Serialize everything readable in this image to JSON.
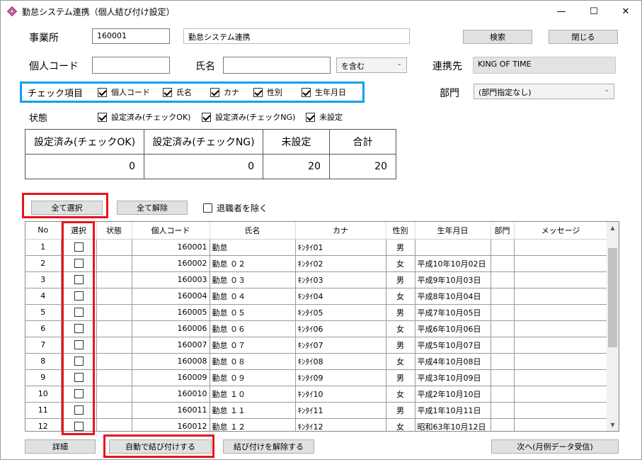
{
  "window": {
    "title": "勤怠システム連携（個人結び付け設定）",
    "minimize": "—",
    "maximize": "☐",
    "close": "✕"
  },
  "office": {
    "label": "事業所",
    "code": "160001",
    "name": "勤怠システム連携"
  },
  "search_button": "検索",
  "close_button": "閉じる",
  "person": {
    "code_label": "個人コード",
    "code_value": "",
    "name_label": "氏名",
    "name_value": "",
    "match_select": "を含む"
  },
  "partner": {
    "label": "連携先",
    "value": "KING OF TIME"
  },
  "check_items": {
    "label": "チェック項目",
    "options": [
      {
        "label": "個人コード",
        "checked": true
      },
      {
        "label": "氏名",
        "checked": true
      },
      {
        "label": "カナ",
        "checked": true
      },
      {
        "label": "性別",
        "checked": true
      },
      {
        "label": "生年月日",
        "checked": true
      }
    ]
  },
  "department": {
    "label": "部門",
    "value": "(部門指定なし)"
  },
  "status": {
    "label": "状態",
    "options": [
      {
        "label": "設定済み(チェックOK)",
        "checked": true
      },
      {
        "label": "設定済み(チェックNG)",
        "checked": true
      },
      {
        "label": "未設定",
        "checked": true
      }
    ]
  },
  "summary": {
    "headers": [
      "設定済み(チェックOK)",
      "設定済み(チェックNG)",
      "未設定",
      "合計"
    ],
    "values": [
      "0",
      "0",
      "20",
      "20"
    ]
  },
  "select_all_button": "全て選択",
  "deselect_all_button": "全て解除",
  "exclude_retired": {
    "label": "退職者を除く",
    "checked": false
  },
  "grid": {
    "columns": [
      "No",
      "選択",
      "状態",
      "個人コード",
      "氏名",
      "カナ",
      "性別",
      "生年月日",
      "部門",
      "メッセージ"
    ],
    "rows": [
      {
        "no": "1",
        "status": "",
        "code": "160001",
        "name": "勤怠",
        "kana": "ｷﾝﾀｲ01",
        "gender": "男",
        "birth": ""
      },
      {
        "no": "2",
        "status": "",
        "code": "160002",
        "name": "勤怠 ０２",
        "kana": "ｷﾝﾀｲ02",
        "gender": "女",
        "birth": "平成10年10月02日"
      },
      {
        "no": "3",
        "status": "",
        "code": "160003",
        "name": "勤怠 ０３",
        "kana": "ｷﾝﾀｲ03",
        "gender": "男",
        "birth": "平成9年10月03日"
      },
      {
        "no": "4",
        "status": "",
        "code": "160004",
        "name": "勤怠 ０４",
        "kana": "ｷﾝﾀｲ04",
        "gender": "女",
        "birth": "平成8年10月04日"
      },
      {
        "no": "5",
        "status": "",
        "code": "160005",
        "name": "勤怠 ０５",
        "kana": "ｷﾝﾀｲ05",
        "gender": "男",
        "birth": "平成7年10月05日"
      },
      {
        "no": "6",
        "status": "",
        "code": "160006",
        "name": "勤怠 ０６",
        "kana": "ｷﾝﾀｲ06",
        "gender": "女",
        "birth": "平成6年10月06日"
      },
      {
        "no": "7",
        "status": "",
        "code": "160007",
        "name": "勤怠 ０７",
        "kana": "ｷﾝﾀｲ07",
        "gender": "男",
        "birth": "平成5年10月07日"
      },
      {
        "no": "8",
        "status": "",
        "code": "160008",
        "name": "勤怠 ０８",
        "kana": "ｷﾝﾀｲ08",
        "gender": "女",
        "birth": "平成4年10月08日"
      },
      {
        "no": "9",
        "status": "",
        "code": "160009",
        "name": "勤怠 ０９",
        "kana": "ｷﾝﾀｲ09",
        "gender": "男",
        "birth": "平成3年10月09日"
      },
      {
        "no": "10",
        "status": "",
        "code": "160010",
        "name": "勤怠 １０",
        "kana": "ｷﾝﾀｲ10",
        "gender": "女",
        "birth": "平成2年10月10日"
      },
      {
        "no": "11",
        "status": "",
        "code": "160011",
        "name": "勤怠 １１",
        "kana": "ｷﾝﾀｲ11",
        "gender": "男",
        "birth": "平成1年10月11日"
      },
      {
        "no": "12",
        "status": "",
        "code": "160012",
        "name": "勤怠 １２",
        "kana": "ｷﾝﾀｲ12",
        "gender": "女",
        "birth": "昭和63年10月12日"
      }
    ]
  },
  "bottom": {
    "detail": "詳細",
    "auto_link": "自動で結び付けする",
    "unlink": "結び付けを解除する",
    "next": "次へ(月例データ受信)"
  },
  "colors": {
    "highlight_red": "#e8141e",
    "highlight_blue": "#0ea0ef"
  }
}
